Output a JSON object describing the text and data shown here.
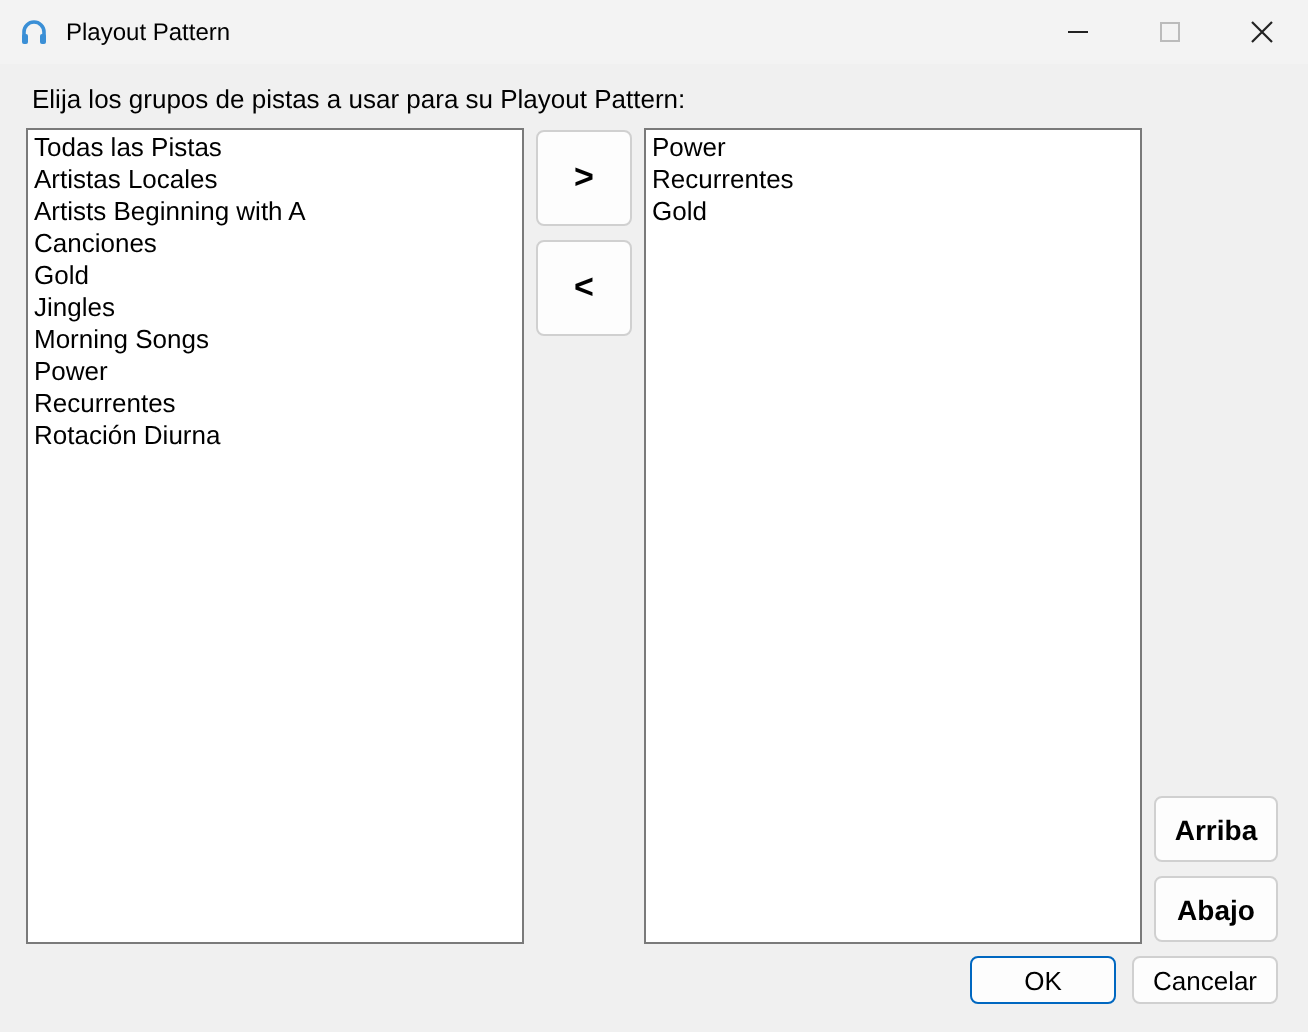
{
  "window": {
    "title": "Playout Pattern"
  },
  "instruction": "Elija los grupos de pistas a usar para su Playout Pattern:",
  "available_list": {
    "items": [
      "Todas las Pistas",
      "Artistas Locales",
      "Artists Beginning with A",
      "Canciones",
      "Gold",
      "Jingles",
      "Morning Songs",
      "Power",
      "Recurrentes",
      "Rotación Diurna"
    ]
  },
  "move_buttons": [
    ">",
    "<"
  ],
  "selected_list": {
    "items": [
      "Power",
      "Recurrentes",
      "Gold"
    ]
  },
  "order_buttons": [
    "Arriba",
    "Abajo"
  ],
  "dialog_buttons": [
    {
      "label": "OK",
      "default": true
    },
    {
      "label": "Cancelar",
      "default": false
    }
  ]
}
